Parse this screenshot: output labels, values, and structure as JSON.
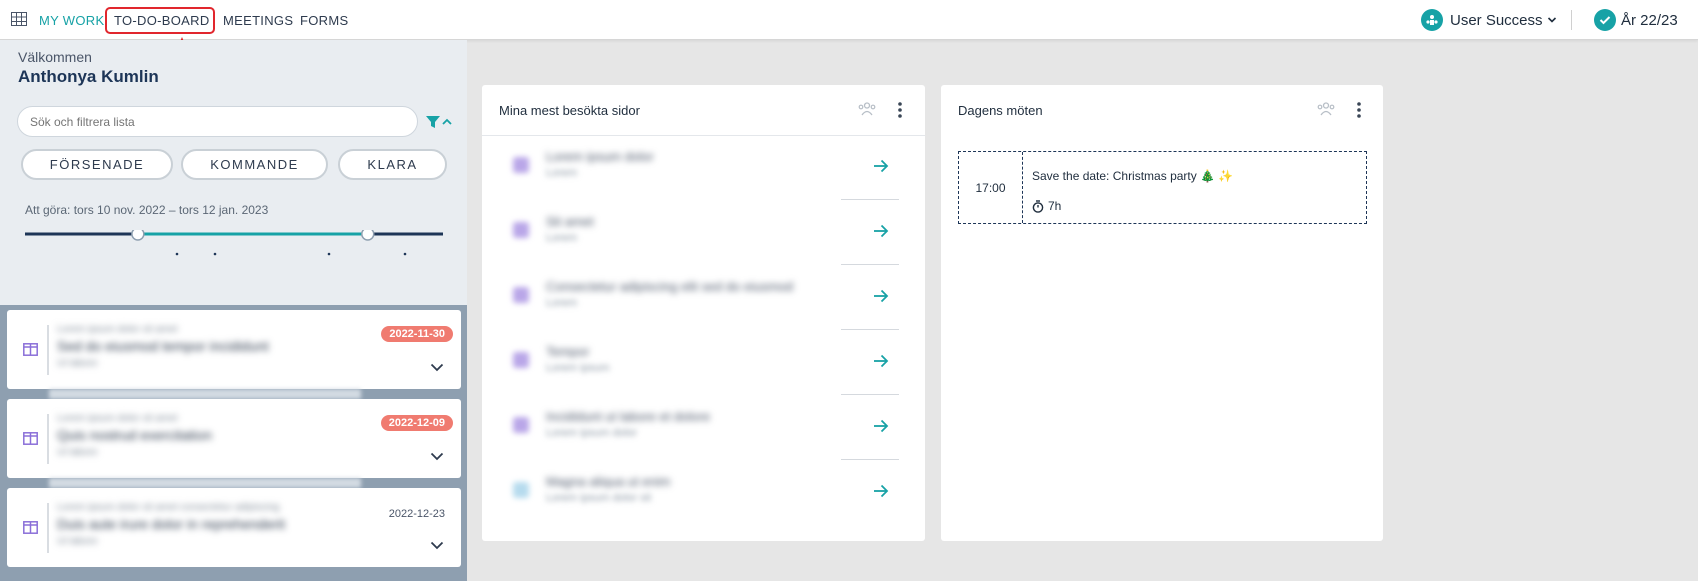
{
  "nav": {
    "items": [
      {
        "label": "MY WORK",
        "active": true
      },
      {
        "label": "TO-DO-BOARD",
        "active": false
      },
      {
        "label": "MEETINGS",
        "active": false
      },
      {
        "label": "FORMS",
        "active": false
      }
    ],
    "org_label": "User Success",
    "year_label": "År 22/23"
  },
  "sidebar": {
    "welcome": "Välkommen",
    "user_name": "Anthonya Kumlin",
    "search_placeholder": "Sök och filtrera lista",
    "filters": [
      "FÖRSENADE",
      "KOMMANDE",
      "KLARA"
    ],
    "range_label": "Att göra: tors 10 nov. 2022 – tors 12 jan. 2023",
    "range_selection": [
      0.27,
      0.82
    ],
    "tasks": [
      {
        "kicker": "Lorem ipsum dolor sit amet",
        "title": "Sed do eiusmod tempor incididunt",
        "sub": "Ut labore",
        "date": "2022-11-30",
        "overdue": true
      },
      {
        "kicker": "Lorem ipsum dolor sit amet",
        "title": "Quis nostrud exercitation",
        "sub": "Ut labore",
        "date": "2022-12-09",
        "overdue": true
      },
      {
        "kicker": "Lorem ipsum dolor sit amet consectetur adipiscing",
        "title": "Duis aute irure dolor in reprehenderit",
        "sub": "Ut labore",
        "date": "2022-12-23",
        "overdue": false
      }
    ]
  },
  "visited": {
    "title": "Mina mest besökta sidor",
    "rows": [
      {
        "name": "Lorem ipsum dolor",
        "sub": "Lorem"
      },
      {
        "name": "Sit amet",
        "sub": "Lorem"
      },
      {
        "name": "Consectetur adipiscing elit sed do eiusmod",
        "sub": "Lorem"
      },
      {
        "name": "Tempor",
        "sub": "Lorem ipsum"
      },
      {
        "name": "Incididunt ut labore et dolore",
        "sub": "Lorem ipsum dolor"
      },
      {
        "name": "Magna aliqua ut enim",
        "sub": "Lorem ipsum dolor sit"
      }
    ]
  },
  "meetings": {
    "title": "Dagens möten",
    "items": [
      {
        "time": "17:00",
        "title": "Save the date: Christmas party 🎄 ✨",
        "duration": "7h"
      }
    ]
  },
  "colors": {
    "accent": "#17a2a6",
    "overdue": "#f07b70",
    "highlight": "#e1262d"
  }
}
